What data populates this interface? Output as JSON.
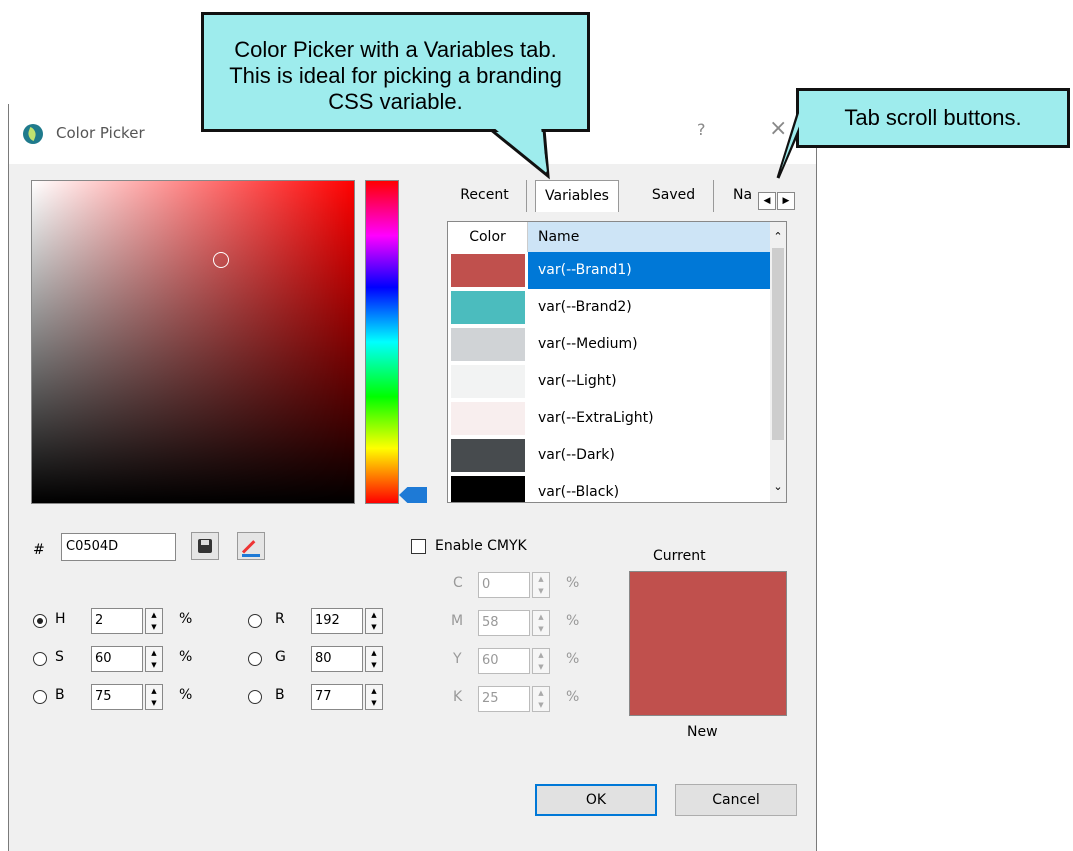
{
  "dialog": {
    "title": "Color Picker",
    "help_label": "?",
    "close_label": "×"
  },
  "tabs": [
    {
      "label": "Recent"
    },
    {
      "label": "Variables"
    },
    {
      "label": "Saved"
    },
    {
      "label": "Na"
    }
  ],
  "tab_scroll": {
    "left": "◀",
    "right": "▶"
  },
  "list": {
    "header_color": "Color",
    "header_name": "Name",
    "rows": [
      {
        "color": "#c0504d",
        "name": "var(--Brand1)",
        "selected": true
      },
      {
        "color": "#4bbcbe",
        "name": "var(--Brand2)"
      },
      {
        "color": "#d0d3d6",
        "name": "var(--Medium)"
      },
      {
        "color": "#f2f3f3",
        "name": "var(--Light)"
      },
      {
        "color": "#f8eeee",
        "name": "var(--ExtraLight)"
      },
      {
        "color": "#474b4e",
        "name": "var(--Dark)"
      },
      {
        "color": "#000000",
        "name": "var(--Black)"
      }
    ]
  },
  "hex": {
    "label": "#",
    "value": "C0504D"
  },
  "hsb": [
    {
      "label": "H",
      "value": "2",
      "unit": "%",
      "checked": true
    },
    {
      "label": "S",
      "value": "60",
      "unit": "%"
    },
    {
      "label": "B",
      "value": "75",
      "unit": "%"
    }
  ],
  "rgb": [
    {
      "label": "R",
      "value": "192"
    },
    {
      "label": "G",
      "value": "80"
    },
    {
      "label": "B",
      "value": "77"
    }
  ],
  "cmyk": {
    "enable_label": "Enable CMYK",
    "fields": [
      {
        "label": "C",
        "value": "0",
        "unit": "%"
      },
      {
        "label": "M",
        "value": "58",
        "unit": "%"
      },
      {
        "label": "Y",
        "value": "60",
        "unit": "%"
      },
      {
        "label": "K",
        "value": "25",
        "unit": "%"
      }
    ]
  },
  "preview": {
    "current_label": "Current",
    "new_label": "New",
    "color": "#c0504d"
  },
  "buttons": {
    "ok": "OK",
    "cancel": "Cancel"
  },
  "callouts": {
    "variables_lines": [
      "Color Picker with a Variables tab.",
      "This is ideal for picking a branding",
      "CSS variable."
    ],
    "scroll": "Tab scroll buttons."
  }
}
